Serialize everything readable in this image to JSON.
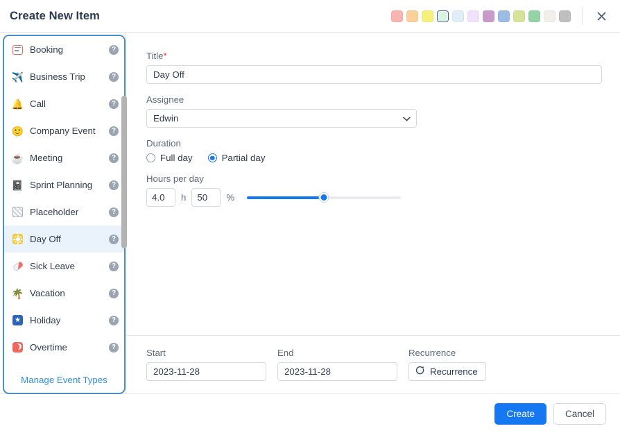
{
  "header": {
    "title": "Create New Item",
    "close_icon": "close-icon",
    "selected_swatch_index": 3,
    "swatches": [
      {
        "name": "swatch-red",
        "color": "#f9b3b0"
      },
      {
        "name": "swatch-orange",
        "color": "#fbd19a"
      },
      {
        "name": "swatch-yellow",
        "color": "#f7f07d"
      },
      {
        "name": "swatch-mint",
        "color": "#d6f5e4"
      },
      {
        "name": "swatch-light-blue",
        "color": "#e0eef8"
      },
      {
        "name": "swatch-lavender",
        "color": "#f0e2fa"
      },
      {
        "name": "swatch-purple",
        "color": "#c99bc9"
      },
      {
        "name": "swatch-blue",
        "color": "#9dbce4"
      },
      {
        "name": "swatch-lime",
        "color": "#d8e39a"
      },
      {
        "name": "swatch-green",
        "color": "#94d3a6"
      },
      {
        "name": "swatch-cream",
        "color": "#f2efe8"
      },
      {
        "name": "swatch-grey",
        "color": "#bfbfbf"
      }
    ]
  },
  "sidebar": {
    "selected_index": 7,
    "help_glyph": "?",
    "manage_link": "Manage Event Types",
    "items": [
      {
        "label": "Booking",
        "icon": "booking-card-icon"
      },
      {
        "label": "Business Trip",
        "icon": "airplane-icon",
        "glyph": "✈️"
      },
      {
        "label": "Call",
        "icon": "bell-icon",
        "glyph": "🔔"
      },
      {
        "label": "Company Event",
        "icon": "smiley-icon",
        "glyph": "🙂"
      },
      {
        "label": "Meeting",
        "icon": "coffee-cup-icon",
        "glyph": "☕"
      },
      {
        "label": "Sprint Planning",
        "icon": "notepad-icon",
        "glyph": "📓"
      },
      {
        "label": "Placeholder",
        "icon": "hatched-square-icon"
      },
      {
        "label": "Day Off",
        "icon": "sun-icon"
      },
      {
        "label": "Sick Leave",
        "icon": "pill-icon"
      },
      {
        "label": "Vacation",
        "icon": "palm-beach-icon",
        "glyph": "🌴"
      },
      {
        "label": "Holiday",
        "icon": "star-icon",
        "glyph": "★"
      },
      {
        "label": "Overtime",
        "icon": "moon-icon"
      }
    ]
  },
  "form": {
    "title_label": "Title",
    "title_required_marker": "*",
    "title_value": "Day Off",
    "title_placeholder": "Title",
    "assignee_label": "Assignee",
    "assignee_value": "Edwin",
    "assignee_caret_icon": "chevron-down-icon",
    "duration_label": "Duration",
    "duration_options": [
      {
        "label": "Full day",
        "checked": false
      },
      {
        "label": "Partial day",
        "checked": true
      }
    ],
    "hours_label": "Hours per day",
    "hours_value": "4.0",
    "hours_unit": "h",
    "percent_value": "50",
    "percent_unit": "%",
    "slider_percent": 50
  },
  "bottom": {
    "start_label": "Start",
    "start_value": "2023-11-28",
    "end_label": "End",
    "end_value": "2023-11-28",
    "recurrence_label": "Recurrence",
    "recurrence_button": "Recurrence",
    "recurrence_icon": "repeat-icon"
  },
  "footer": {
    "create_label": "Create",
    "cancel_label": "Cancel"
  },
  "colors": {
    "accent": "#1677f2",
    "link": "#2e8fe0",
    "panel_border": "#4a90c4",
    "required": "#e0352b"
  }
}
